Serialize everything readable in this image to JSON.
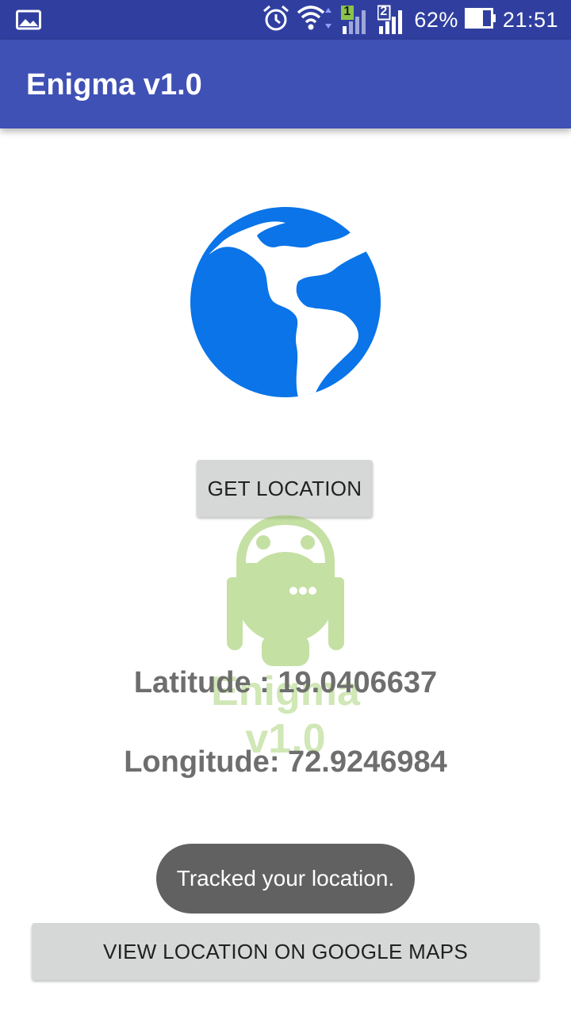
{
  "status_bar": {
    "battery_percent": "62%",
    "time": "21:51",
    "sim1_label": "1",
    "sim2_label": "2",
    "icons": [
      "gallery-icon",
      "alarm-icon",
      "wifi-icon",
      "signal-sim1-icon",
      "signal-sim2-icon",
      "battery-icon"
    ]
  },
  "app_bar": {
    "title": "Enigma v1.0"
  },
  "main": {
    "globe_icon": "globe-icon",
    "get_location_label": "GET LOCATION",
    "watermark_text": "Enigma v1.0",
    "latitude_text": "Latitude : 19.0406637",
    "longitude_text": "Longitude: 72.9246984",
    "view_maps_label": "VIEW LOCATION ON GOOGLE MAPS"
  },
  "toast": {
    "message": "Tracked your location."
  },
  "colors": {
    "status_bar": "#303f9f",
    "app_bar": "#3f51b5",
    "globe": "#0a74e8",
    "button": "#d6d7d7",
    "coord_text": "#6e6e6e",
    "toast": "#616161",
    "sim1_badge": "#8bc34a"
  }
}
